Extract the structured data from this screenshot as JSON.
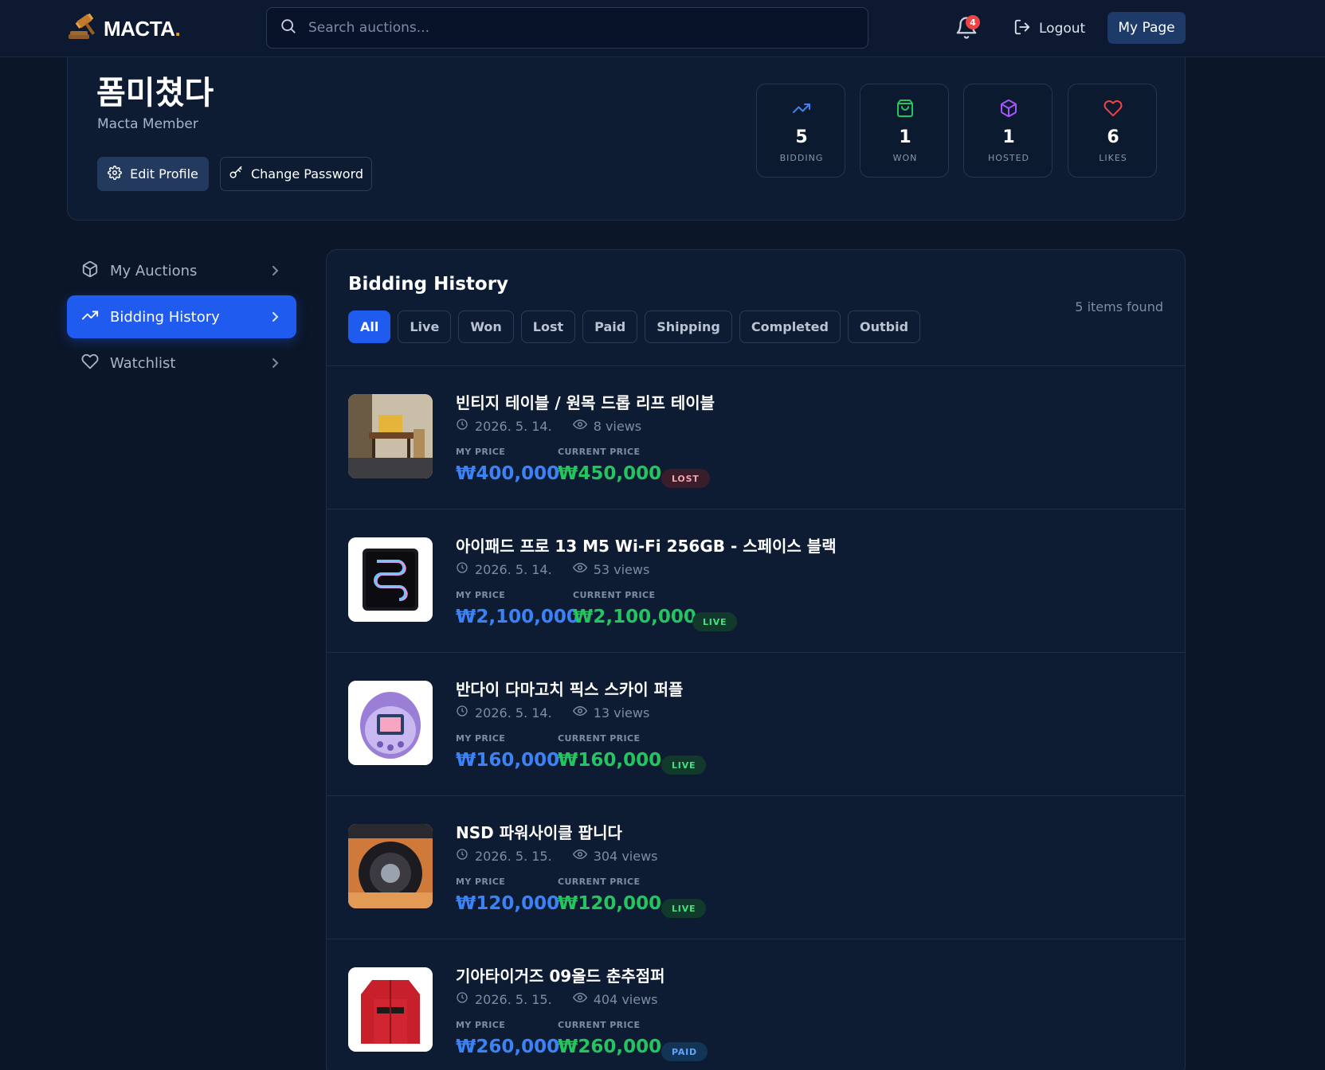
{
  "header": {
    "logo_text": "MACTA",
    "logo_dot": ".",
    "search_placeholder": "Search auctions...",
    "notification_count": "4",
    "logout_label": "Logout",
    "mypage_label": "My Page"
  },
  "profile": {
    "name": "폼미쳤다",
    "role": "Macta Member",
    "edit_label": "Edit Profile",
    "password_label": "Change Password",
    "stats": [
      {
        "value": "5",
        "label": "BIDDING",
        "icon": "trending-up-icon",
        "color": "#3b82f6"
      },
      {
        "value": "1",
        "label": "WON",
        "icon": "shopping-bag-icon",
        "color": "#22c55e"
      },
      {
        "value": "1",
        "label": "HOSTED",
        "icon": "package-icon",
        "color": "#a855f7"
      },
      {
        "value": "6",
        "label": "LIKES",
        "icon": "heart-icon",
        "color": "#ef4444"
      }
    ]
  },
  "sidebar": {
    "items": [
      {
        "label": "My Auctions",
        "icon": "package-icon",
        "active": false
      },
      {
        "label": "Bidding History",
        "icon": "trending-up-icon",
        "active": true
      },
      {
        "label": "Watchlist",
        "icon": "heart-icon",
        "active": false
      }
    ]
  },
  "panel": {
    "title": "Bidding History",
    "items_found": "5 items found",
    "filters": [
      "All",
      "Live",
      "Won",
      "Lost",
      "Paid",
      "Shipping",
      "Completed",
      "Outbid"
    ],
    "active_filter": "All",
    "my_price_label": "MY PRICE",
    "current_price_label": "CURRENT PRICE",
    "items": [
      {
        "title": "빈티지 테이블 / 원목 드롭 리프 테이블",
        "date": "2026. 5. 14.",
        "views": "8 views",
        "my_price": "₩400,000",
        "current_price": "₩450,000",
        "status": "LOST",
        "status_type": "lost"
      },
      {
        "title": "아이패드 프로 13 M5 Wi-Fi 256GB - 스페이스 블랙",
        "date": "2026. 5. 14.",
        "views": "53 views",
        "my_price": "₩2,100,000",
        "current_price": "₩2,100,000",
        "status": "LIVE",
        "status_type": "live"
      },
      {
        "title": "반다이 다마고치 픽스 스카이 퍼플",
        "date": "2026. 5. 14.",
        "views": "13 views",
        "my_price": "₩160,000",
        "current_price": "₩160,000",
        "status": "LIVE",
        "status_type": "live"
      },
      {
        "title": "NSD 파워사이클 팝니다",
        "date": "2026. 5. 15.",
        "views": "304 views",
        "my_price": "₩120,000",
        "current_price": "₩120,000",
        "status": "LIVE",
        "status_type": "live"
      },
      {
        "title": "기아타이거즈 09올드 춘추점퍼",
        "date": "2026. 5. 15.",
        "views": "404 views",
        "my_price": "₩260,000",
        "current_price": "₩260,000",
        "status": "PAID",
        "status_type": "paid"
      }
    ]
  }
}
